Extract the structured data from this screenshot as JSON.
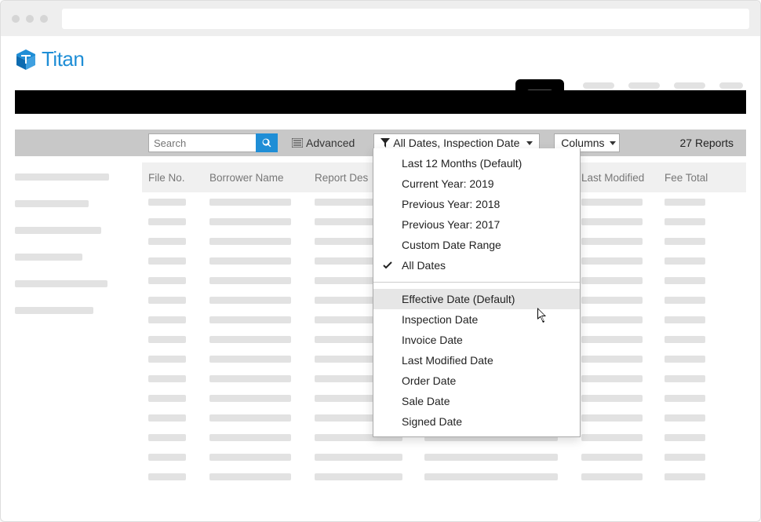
{
  "app": {
    "name": "Titan"
  },
  "toolbar": {
    "search_placeholder": "Search",
    "advanced_label": "Advanced",
    "date_filter_label": "All Dates, Inspection Date",
    "columns_label": "Columns",
    "report_count": "27 Reports"
  },
  "table": {
    "headers": {
      "file_no": "File No.",
      "borrower": "Borrower Name",
      "report_desc": "Report Des",
      "last_modified": "Last Modified",
      "fee_total": "Fee Total"
    }
  },
  "date_menu": {
    "range_items": [
      {
        "label": "Last 12 Months (Default)",
        "checked": false
      },
      {
        "label": "Current Year: 2019",
        "checked": false
      },
      {
        "label": "Previous Year: 2018",
        "checked": false
      },
      {
        "label": "Previous Year: 2017",
        "checked": false
      },
      {
        "label": "Custom Date Range",
        "checked": false
      },
      {
        "label": "All Dates",
        "checked": true
      }
    ],
    "field_items": [
      {
        "label": "Effective Date (Default)",
        "hovered": true
      },
      {
        "label": "Inspection Date"
      },
      {
        "label": "Invoice Date"
      },
      {
        "label": "Last Modified Date"
      },
      {
        "label": "Order Date"
      },
      {
        "label": "Sale Date"
      },
      {
        "label": "Signed Date"
      }
    ]
  }
}
